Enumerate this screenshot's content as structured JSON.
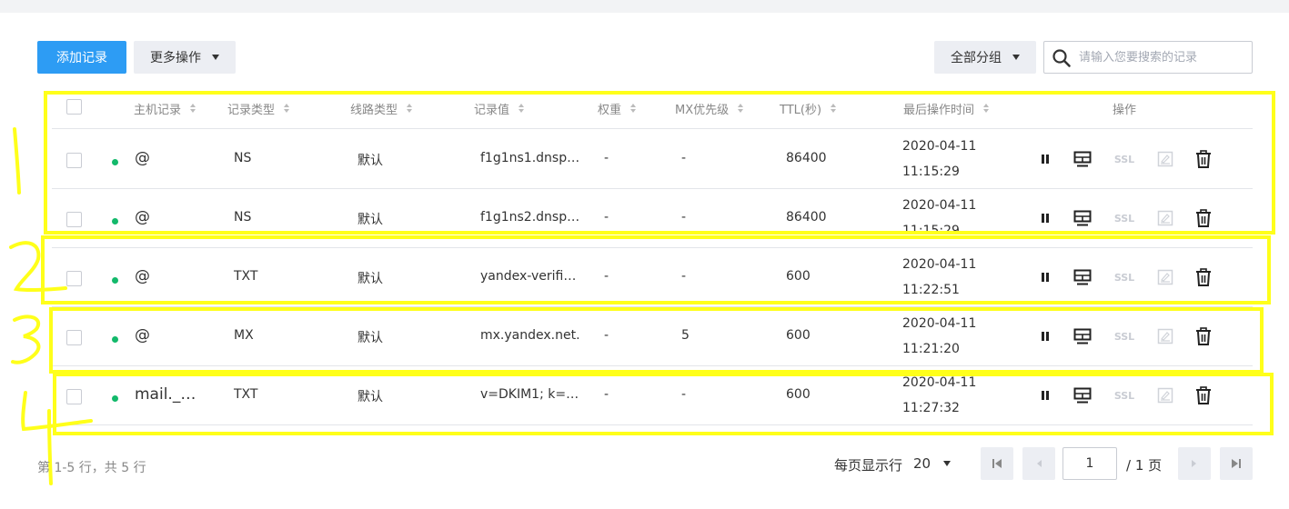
{
  "toolbar": {
    "add_label": "添加记录",
    "more_label": "更多操作",
    "group_label": "全部分组",
    "search_placeholder": "请输入您要搜索的记录"
  },
  "columns": {
    "host": "主机记录",
    "type": "记录类型",
    "line": "线路类型",
    "value": "记录值",
    "weight": "权重",
    "mx": "MX优先级",
    "ttl": "TTL(秒)",
    "time": "最后操作时间",
    "actions": "操作"
  },
  "rows": [
    {
      "host": "@",
      "type": "NS",
      "line": "默认",
      "value": "f1g1ns1.dnsp…",
      "weight": "-",
      "mx": "-",
      "ttl": "86400",
      "date": "2020-04-11",
      "clock": "11:15:29"
    },
    {
      "host": "@",
      "type": "NS",
      "line": "默认",
      "value": "f1g1ns2.dnsp…",
      "weight": "-",
      "mx": "-",
      "ttl": "86400",
      "date": "2020-04-11",
      "clock": "11:15:29"
    },
    {
      "host": "@",
      "type": "TXT",
      "line": "默认",
      "value": "yandex-verifi…",
      "weight": "-",
      "mx": "-",
      "ttl": "600",
      "date": "2020-04-11",
      "clock": "11:22:51"
    },
    {
      "host": "@",
      "type": "MX",
      "line": "默认",
      "value": "mx.yandex.net.",
      "weight": "-",
      "mx": "5",
      "ttl": "600",
      "date": "2020-04-11",
      "clock": "11:21:20"
    },
    {
      "host": "mail._…",
      "type": "TXT",
      "line": "默认",
      "value": "v=DKIM1; k=r…",
      "weight": "-",
      "mx": "-",
      "ttl": "600",
      "date": "2020-04-11",
      "clock": "11:27:32"
    }
  ],
  "action_labels": {
    "ssl": "SSL"
  },
  "icons": {
    "pause": "pause-icon",
    "monitor": "monitor-icon",
    "ssl": "ssl-icon",
    "note": "note-icon",
    "delete": "trash-icon",
    "search": "search-icon"
  },
  "footer": {
    "summary": "第 1-5 行，共 5 行",
    "per_page_label": "每页显示行",
    "per_page_value": "20",
    "page_value": "1",
    "page_total": "/ 1 页"
  },
  "colors": {
    "primary": "#2d9cf4",
    "status_dot": "#13b96b",
    "highlight": "#ffff1a"
  }
}
